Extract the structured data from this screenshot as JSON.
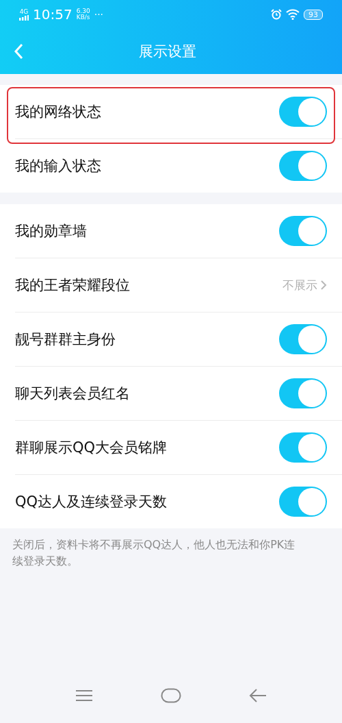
{
  "status_bar": {
    "network": "4G",
    "time": "10:57",
    "speed_value": "6.30",
    "speed_unit": "KB/s",
    "more": "···",
    "battery": "93"
  },
  "header": {
    "title": "展示设置"
  },
  "groups": [
    {
      "rows": [
        {
          "kind": "toggle",
          "label": "我的网络状态",
          "on": true,
          "highlighted": true
        },
        {
          "kind": "toggle",
          "label": "我的输入状态",
          "on": true,
          "highlighted": false
        }
      ]
    },
    {
      "rows": [
        {
          "kind": "toggle",
          "label": "我的勋章墙",
          "on": true,
          "highlighted": false
        },
        {
          "kind": "value",
          "label": "我的王者荣耀段位",
          "value": "不展示",
          "highlighted": false
        },
        {
          "kind": "toggle",
          "label": "靓号群群主身份",
          "on": true,
          "highlighted": false
        },
        {
          "kind": "toggle",
          "label": "聊天列表会员红名",
          "on": true,
          "highlighted": false
        },
        {
          "kind": "toggle",
          "label": "群聊展示QQ大会员铭牌",
          "on": true,
          "highlighted": false
        },
        {
          "kind": "toggle",
          "label": "QQ达人及连续登录天数",
          "on": true,
          "highlighted": false
        }
      ]
    }
  ],
  "footnote": "关闭后，资料卡将不再展示QQ达人，他人也无法和你PK连续登录天数。"
}
